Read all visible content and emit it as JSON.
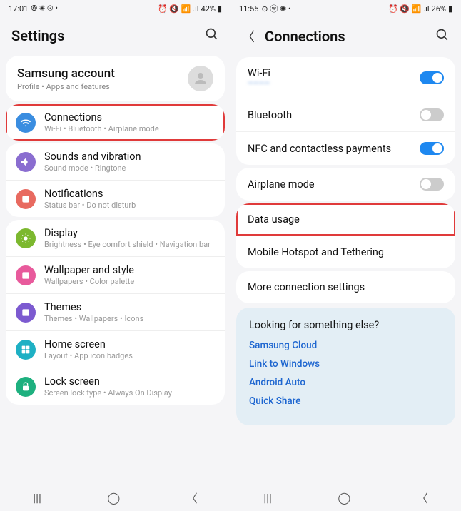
{
  "left": {
    "status": {
      "time": "17:01",
      "leftIcons": "⦾ ✺ ⊙ •",
      "rightIcons": "⏰ 🔇 📶 .ıl",
      "battery": "42%"
    },
    "header": {
      "title": "Settings"
    },
    "account": {
      "title": "Samsung account",
      "sub": "Profile  •  Apps and features"
    },
    "groups": [
      {
        "items": [
          {
            "icon": "wifi",
            "color": "#3a8de0",
            "title": "Connections",
            "sub": "Wi-Fi  •  Bluetooth  •  Airplane mode",
            "highlight": true
          }
        ]
      },
      {
        "items": [
          {
            "icon": "sound",
            "color": "#8a6dd0",
            "title": "Sounds and vibration",
            "sub": "Sound mode  •  Ringtone"
          },
          {
            "icon": "notif",
            "color": "#e86a60",
            "title": "Notifications",
            "sub": "Status bar  •  Do not disturb"
          }
        ]
      },
      {
        "items": [
          {
            "icon": "display",
            "color": "#7cb82f",
            "title": "Display",
            "sub": "Brightness  •  Eye comfort shield  •  Navigation bar"
          },
          {
            "icon": "wallpaper",
            "color": "#e85a9c",
            "title": "Wallpaper and style",
            "sub": "Wallpapers  •  Color palette"
          },
          {
            "icon": "themes",
            "color": "#7c5ad0",
            "title": "Themes",
            "sub": "Themes  •  Wallpapers  •  Icons"
          },
          {
            "icon": "home",
            "color": "#1eb0c4",
            "title": "Home screen",
            "sub": "Layout  •  App icon badges"
          },
          {
            "icon": "lock",
            "color": "#1eb07f",
            "title": "Lock screen",
            "sub": "Screen lock type  •  Always On Display"
          }
        ]
      }
    ]
  },
  "right": {
    "status": {
      "time": "11:55",
      "leftIcons": "⊙ ⓦ ✺ •",
      "rightIcons": "⏰ 🔇 📶 .ıl",
      "battery": "26%"
    },
    "header": {
      "title": "Connections"
    },
    "groups": [
      {
        "items": [
          {
            "title": "Wi-Fi",
            "sub": "————",
            "toggle": "on"
          },
          {
            "title": "Bluetooth",
            "toggle": "off"
          },
          {
            "title": "NFC and contactless payments",
            "toggle": "on"
          }
        ]
      },
      {
        "items": [
          {
            "title": "Airplane mode",
            "toggle": "off"
          }
        ]
      },
      {
        "items": [
          {
            "title": "Data usage",
            "highlight": true
          },
          {
            "title": "Mobile Hotspot and Tethering"
          }
        ]
      },
      {
        "items": [
          {
            "title": "More connection settings"
          }
        ]
      }
    ],
    "suggestions": {
      "title": "Looking for something else?",
      "links": [
        "Samsung Cloud",
        "Link to Windows",
        "Android Auto",
        "Quick Share"
      ]
    }
  }
}
